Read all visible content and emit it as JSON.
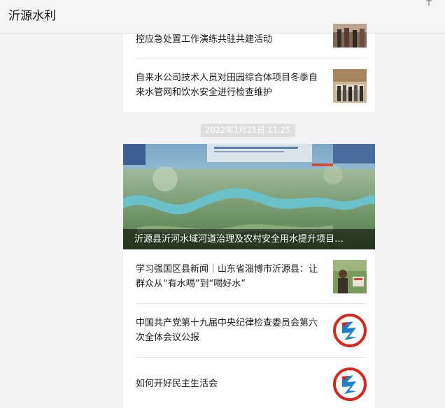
{
  "window": {
    "title": "沂源水利",
    "pin_icon": "pin-icon"
  },
  "feed_top": {
    "items": [
      {
        "title": "控应急处置工作演练共驻共建活动",
        "thumb_icon": "news-photo-thumbnail"
      },
      {
        "title": "自来水公司技术人员对田园综合体项目冬季自来水管网和饮水安全进行检查维护",
        "thumb_icon": "news-photo-thumbnail"
      }
    ]
  },
  "timestamp": "2022年1月21日  11:25",
  "feed_bottom": {
    "hero": {
      "title": "沂源县沂河水域河道治理及农村安全用水提升项目…",
      "image_icon": "river-aerial-image"
    },
    "items": [
      {
        "title": "学习强国区县新闻｜山东省淄博市沂源县：让群众从“有水喝”到“喝好水”",
        "thumb_icon": "news-photo-thumbnail"
      },
      {
        "title": "中国共产党第十九届中央纪律检查委员会第六次全体会议公报",
        "thumb_icon": "party-logo-icon"
      },
      {
        "title": "如何开好民主生活会",
        "thumb_icon": "party-logo-icon"
      }
    ]
  },
  "colors": {
    "background": "#f3f3f3",
    "card": "#ffffff",
    "caption_overlay": "#000000",
    "logo_red": "#d7261e",
    "logo_blue": "#1d7fd0"
  }
}
